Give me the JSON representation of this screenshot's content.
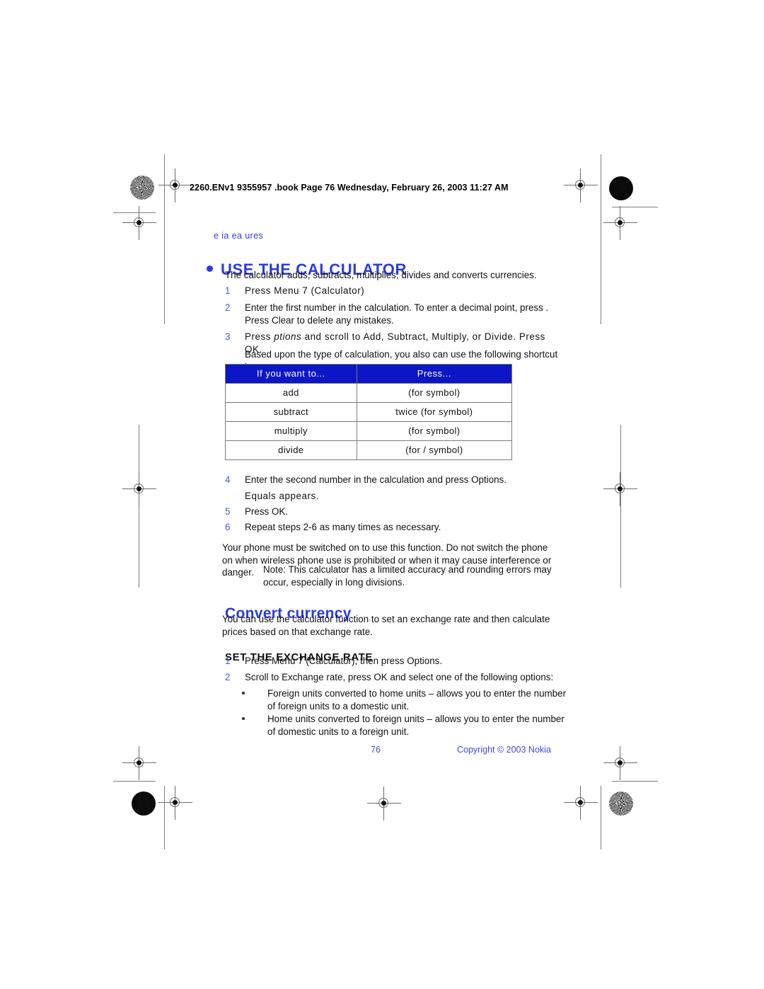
{
  "file_header": "2260.ENv1 9355957 .book  Page 76  Wednesday, February 26, 2003  11:27 AM",
  "running_head": "e  ia   ea ures",
  "colors": {
    "heading_blue": "#2a3cdd",
    "table_header_blue": "#0c16c6",
    "list_number_blue": "#4459e8",
    "footer_blue": "#3a4de6"
  },
  "section": {
    "title": "USE THE CALCULATOR",
    "intro": "The calculator adds, subtracts, multiplies, divides and converts currencies.",
    "steps": [
      {
        "num": "1",
        "text": "Press Menu 7 (Calculator)"
      },
      {
        "num": "2",
        "text": "Enter the first number in the calculation. To enter a decimal point, press   . Press Clear to delete any mistakes."
      },
      {
        "num": "3",
        "text_before": "Press  ",
        "text_italic": "ptions",
        "text_after": " and scroll to Add, Subtract, Multiply, or Divide. Press OK."
      }
    ],
    "step3_followup": "Based upon the type of calculation, you also can use the following shortcut keys:",
    "table": {
      "headers": [
        "If you want to...",
        "Press..."
      ],
      "rows": [
        [
          "add",
          "(for   symbol)"
        ],
        [
          "subtract",
          "twice (for   symbol)"
        ],
        [
          "multiply",
          "(for   symbol)"
        ],
        [
          "divide",
          "(for / symbol)"
        ]
      ]
    },
    "steps_after": [
      {
        "num": "4",
        "text": "Enter the second number in the calculation and press Options."
      },
      {
        "num": "",
        "text": "Equals appears."
      },
      {
        "num": "5",
        "text": "Press OK."
      },
      {
        "num": "6",
        "text": "Repeat steps 2-6 as many times as necessary."
      }
    ],
    "warning": "Your phone must be switched on to use this function. Do not switch the phone on when wireless phone use is prohibited or when it may cause interference or danger.",
    "note": "Note: This calculator has a limited accuracy and rounding errors may occur, especially in long divisions."
  },
  "convert_currency": {
    "title": "Convert currency",
    "intro": "You can use the calculator function to set an exchange rate and then calculate prices based on that exchange rate.",
    "subheading": "SET THE EXCHANGE RATE",
    "steps": [
      {
        "num": "1",
        "text": "Press Menu 7 (Calculator), then press Options."
      },
      {
        "num": "2",
        "text": "Scroll to Exchange rate, press OK and select one of the following options:"
      }
    ],
    "options": [
      "Foreign units converted to home units – allows you to enter the number of foreign units to a domestic unit.",
      "Home units converted to foreign units – allows you to enter the number of domestic units to a foreign unit."
    ]
  },
  "footer": {
    "page_number": "76",
    "copyright": "Copyright © 2003 Nokia"
  }
}
